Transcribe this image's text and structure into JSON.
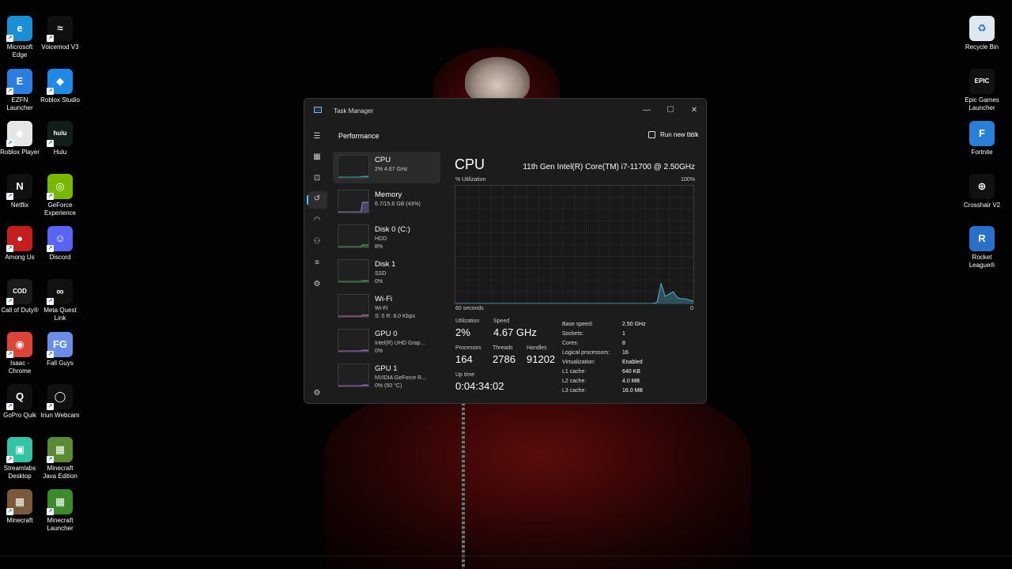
{
  "desktop_left": [
    {
      "label": "Microsoft Edge",
      "color": "#1a8fd6",
      "glyph": "e"
    },
    {
      "label": "Voicemod V3",
      "color": "#111111",
      "glyph": "≈"
    },
    {
      "label": "EZFN Launcher",
      "color": "#2b7de0",
      "glyph": "E"
    },
    {
      "label": "Roblox Studio",
      "color": "#1e8ae6",
      "glyph": "◆"
    },
    {
      "label": "Roblox Player",
      "color": "#e6e6e6",
      "glyph": "◆"
    },
    {
      "label": "Hulu",
      "color": "#102018",
      "glyph": "hulu"
    },
    {
      "label": "Netflix",
      "color": "#111111",
      "glyph": "N"
    },
    {
      "label": "GeForce Experience",
      "color": "#76b900",
      "glyph": "◎"
    },
    {
      "label": "Among Us",
      "color": "#c41e1e",
      "glyph": "●"
    },
    {
      "label": "Discord",
      "color": "#5865f2",
      "glyph": "☺"
    },
    {
      "label": "Call of Duty®",
      "color": "#1a1a1a",
      "glyph": "COD"
    },
    {
      "label": "Meta Quest Link",
      "color": "#111111",
      "glyph": "∞"
    },
    {
      "label": "Isaac - Chrome",
      "color": "#db4437",
      "glyph": "◉"
    },
    {
      "label": "Fall Guys",
      "color": "#6a8ee8",
      "glyph": "FG"
    },
    {
      "label": "GoPro Quik",
      "color": "#111111",
      "glyph": "Q"
    },
    {
      "label": "Iriun Webcam",
      "color": "#111111",
      "glyph": "◯"
    },
    {
      "label": "Streamlabs Desktop",
      "color": "#31c3a2",
      "glyph": "▣"
    },
    {
      "label": "Minecraft Java Edition",
      "color": "#5a8a34",
      "glyph": "▦"
    },
    {
      "label": "Minecraft",
      "color": "#7a5a3a",
      "glyph": "▦"
    },
    {
      "label": "Minecraft Launcher",
      "color": "#3c8a2c",
      "glyph": "▦"
    }
  ],
  "desktop_right": [
    {
      "label": "Recycle Bin",
      "color": "#dfe8ee",
      "glyph": "♻"
    },
    {
      "label": "Epic Games Launcher",
      "color": "#111111",
      "glyph": "EPIC"
    },
    {
      "label": "Fortnite",
      "color": "#2a7fd8",
      "glyph": "F"
    },
    {
      "label": "Crosshair V2",
      "color": "#111111",
      "glyph": "⊕"
    },
    {
      "label": "Rocket League®",
      "color": "#2a6fc8",
      "glyph": "R"
    }
  ],
  "window": {
    "title": "Task Manager",
    "minimize": "—",
    "maximize": "☐",
    "close": "✕"
  },
  "header": {
    "title": "Performance",
    "run_task": "Run new task",
    "more": "⋯"
  },
  "nav_icons": [
    "hamburger-icon",
    "processes-icon",
    "performance-icon",
    "app-history-icon",
    "startup-icon",
    "users-icon",
    "details-icon",
    "services-icon",
    "settings-icon"
  ],
  "resources": [
    {
      "name": "CPU",
      "sub1": "2% 4.67 GHz",
      "sub2": "",
      "line": "#4db8d6",
      "usage": 0.02
    },
    {
      "name": "Memory",
      "sub1": "6.7/15.6 GB (43%)",
      "sub2": "",
      "line": "#8f8fe8",
      "usage": 0.43
    },
    {
      "name": "Disk 0 (C:)",
      "sub1": "HDD",
      "sub2": "8%",
      "line": "#5cb85c",
      "usage": 0.08
    },
    {
      "name": "Disk 1",
      "sub1": "SSD",
      "sub2": "0%",
      "line": "#5cb85c",
      "usage": 0
    },
    {
      "name": "Wi-Fi",
      "sub1": "Wi-Fi",
      "sub2": "S: 0 R: 8.0 Kbps",
      "line": "#e07ab8",
      "usage": 0.05
    },
    {
      "name": "GPU 0",
      "sub1": "Intel(R) UHD Grap...",
      "sub2": "0%",
      "line": "#b07ae8",
      "usage": 0
    },
    {
      "name": "GPU 1",
      "sub1": "NVIDIA GeForce R...",
      "sub2": "0% (50 °C)",
      "line": "#b07ae8",
      "usage": 0
    }
  ],
  "cpu": {
    "title": "CPU",
    "model": "11th Gen Intel(R) Core(TM) i7-11700 @ 2.50GHz",
    "util_label": "% Utilization",
    "max_label": "100%",
    "time_label": "60 seconds",
    "min_label": "0",
    "history": [
      0,
      0,
      0,
      0,
      0,
      0,
      0,
      0,
      0,
      0,
      0,
      0,
      0,
      0,
      0,
      0,
      0,
      0,
      0,
      0,
      0,
      0,
      0,
      0,
      0,
      0,
      0,
      0,
      0,
      0,
      0,
      0,
      0,
      0,
      0,
      0,
      0,
      0,
      0,
      0,
      0,
      0,
      0,
      0,
      0,
      0,
      0,
      0,
      0,
      0,
      1,
      17,
      6,
      8,
      10,
      5,
      4,
      4,
      3,
      2
    ],
    "stats": {
      "utilization": {
        "label": "Utilization",
        "value": "2%"
      },
      "speed": {
        "label": "Speed",
        "value": "4.67 GHz"
      },
      "processes": {
        "label": "Processes",
        "value": "164"
      },
      "threads": {
        "label": "Threads",
        "value": "2786"
      },
      "handles": {
        "label": "Handles",
        "value": "91202"
      },
      "uptime": {
        "label": "Up time",
        "value": "0:04:34:02"
      }
    },
    "specs": [
      {
        "key": "Base speed:",
        "value": "2.50 GHz"
      },
      {
        "key": "Sockets:",
        "value": "1"
      },
      {
        "key": "Cores:",
        "value": "8"
      },
      {
        "key": "Logical processors:",
        "value": "16"
      },
      {
        "key": "Virtualization:",
        "value": "Enabled"
      },
      {
        "key": "L1 cache:",
        "value": "640 KB"
      },
      {
        "key": "L2 cache:",
        "value": "4.0 MB"
      },
      {
        "key": "L3 cache:",
        "value": "16.0 MB"
      }
    ]
  }
}
